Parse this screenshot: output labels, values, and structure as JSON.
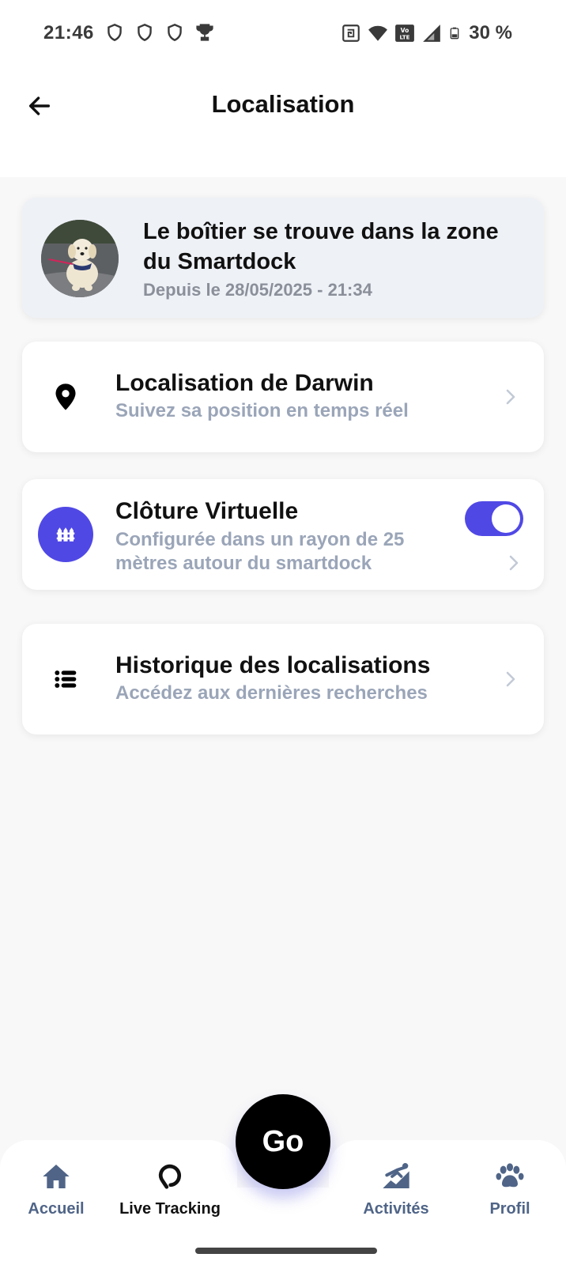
{
  "status_bar": {
    "time": "21:46",
    "left_icons": [
      "shield-icon",
      "shield-icon",
      "shield-icon",
      "trophy-icon"
    ],
    "right_icons": [
      "nfc-icon",
      "wifi-icon",
      "volte-icon",
      "signal-icon",
      "battery-icon"
    ],
    "volte_text": "Vo\nLTE",
    "battery": "30 %"
  },
  "header": {
    "title": "Localisation",
    "back_icon": "arrow-left-icon"
  },
  "status_card": {
    "title": "Le boîtier se trouve dans la zone du Smartdock",
    "since": "Depuis le 28/05/2025 - 21:34"
  },
  "menu": {
    "location": {
      "icon": "map-pin-icon",
      "title": "Localisation de Darwin",
      "subtitle": "Suivez sa position en temps réel"
    },
    "fence": {
      "icon": "fence-icon",
      "title": "Clôture Virtuelle",
      "subtitle": "Configurée dans un rayon de 25 mètres autour du smartdock",
      "toggle_on": true
    },
    "history": {
      "icon": "list-icon",
      "title": "Historique des localisations",
      "subtitle": "Accédez aux dernières recherches"
    }
  },
  "go_button": {
    "label": "Go"
  },
  "nav": {
    "items": [
      {
        "label": "Accueil",
        "icon": "home-icon",
        "active": false
      },
      {
        "label": "Live Tracking",
        "icon": "live-tracking-icon",
        "active": true
      },
      {
        "label": "Activités",
        "icon": "activities-icon",
        "active": false
      },
      {
        "label": "Profil",
        "icon": "paw-icon",
        "active": false
      }
    ]
  },
  "colors": {
    "accent": "#5048e5",
    "nav_inactive": "#4f6487",
    "subtitle": "#9aa5b8"
  }
}
